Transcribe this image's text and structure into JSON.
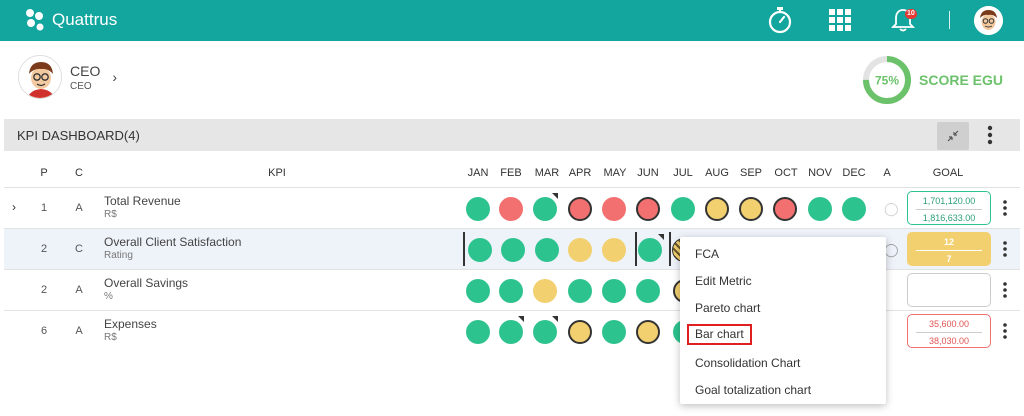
{
  "app": {
    "name": "Quattrus",
    "notification_count": "10"
  },
  "profile": {
    "name": "CEO",
    "role": "CEO"
  },
  "score": {
    "value": "75%",
    "label": "SCORE EGU",
    "fraction": 0.75,
    "color": "#6cc26b"
  },
  "dashboard": {
    "title": "KPI DASHBOARD(4)"
  },
  "columns": {
    "p": "P",
    "c": "C",
    "kpi": "KPI",
    "months": [
      "JAN",
      "FEB",
      "MAR",
      "APR",
      "MAY",
      "JUN",
      "JUL",
      "AUG",
      "SEP",
      "OCT",
      "NOV",
      "DEC"
    ],
    "a": "A",
    "goal": "GOAL"
  },
  "rows": [
    {
      "p": "1",
      "c": "A",
      "name": "Total Revenue",
      "unit": "R$",
      "goal_top": "1,701,120.00",
      "goal_bottom": "1,816,633.00"
    },
    {
      "p": "2",
      "c": "C",
      "name": "Overall Client Satisfaction",
      "unit": "Rating",
      "goal_top": "12",
      "goal_bottom": "7"
    },
    {
      "p": "2",
      "c": "A",
      "name": "Overall Savings",
      "unit": "%",
      "goal_top": "",
      "goal_bottom": ""
    },
    {
      "p": "6",
      "c": "A",
      "name": "Expenses",
      "unit": "R$",
      "goal_top": "35,600.00",
      "goal_bottom": "38,030.00"
    }
  ],
  "context_menu": {
    "items": [
      "FCA",
      "Edit Metric",
      "Pareto chart",
      "Bar chart",
      "Consolidation Chart",
      "Goal totalization chart"
    ]
  },
  "colors": {
    "topbar": "#13a69e",
    "green": "#2dc38f",
    "red": "#f2706f",
    "yellow": "#f3d06f"
  }
}
